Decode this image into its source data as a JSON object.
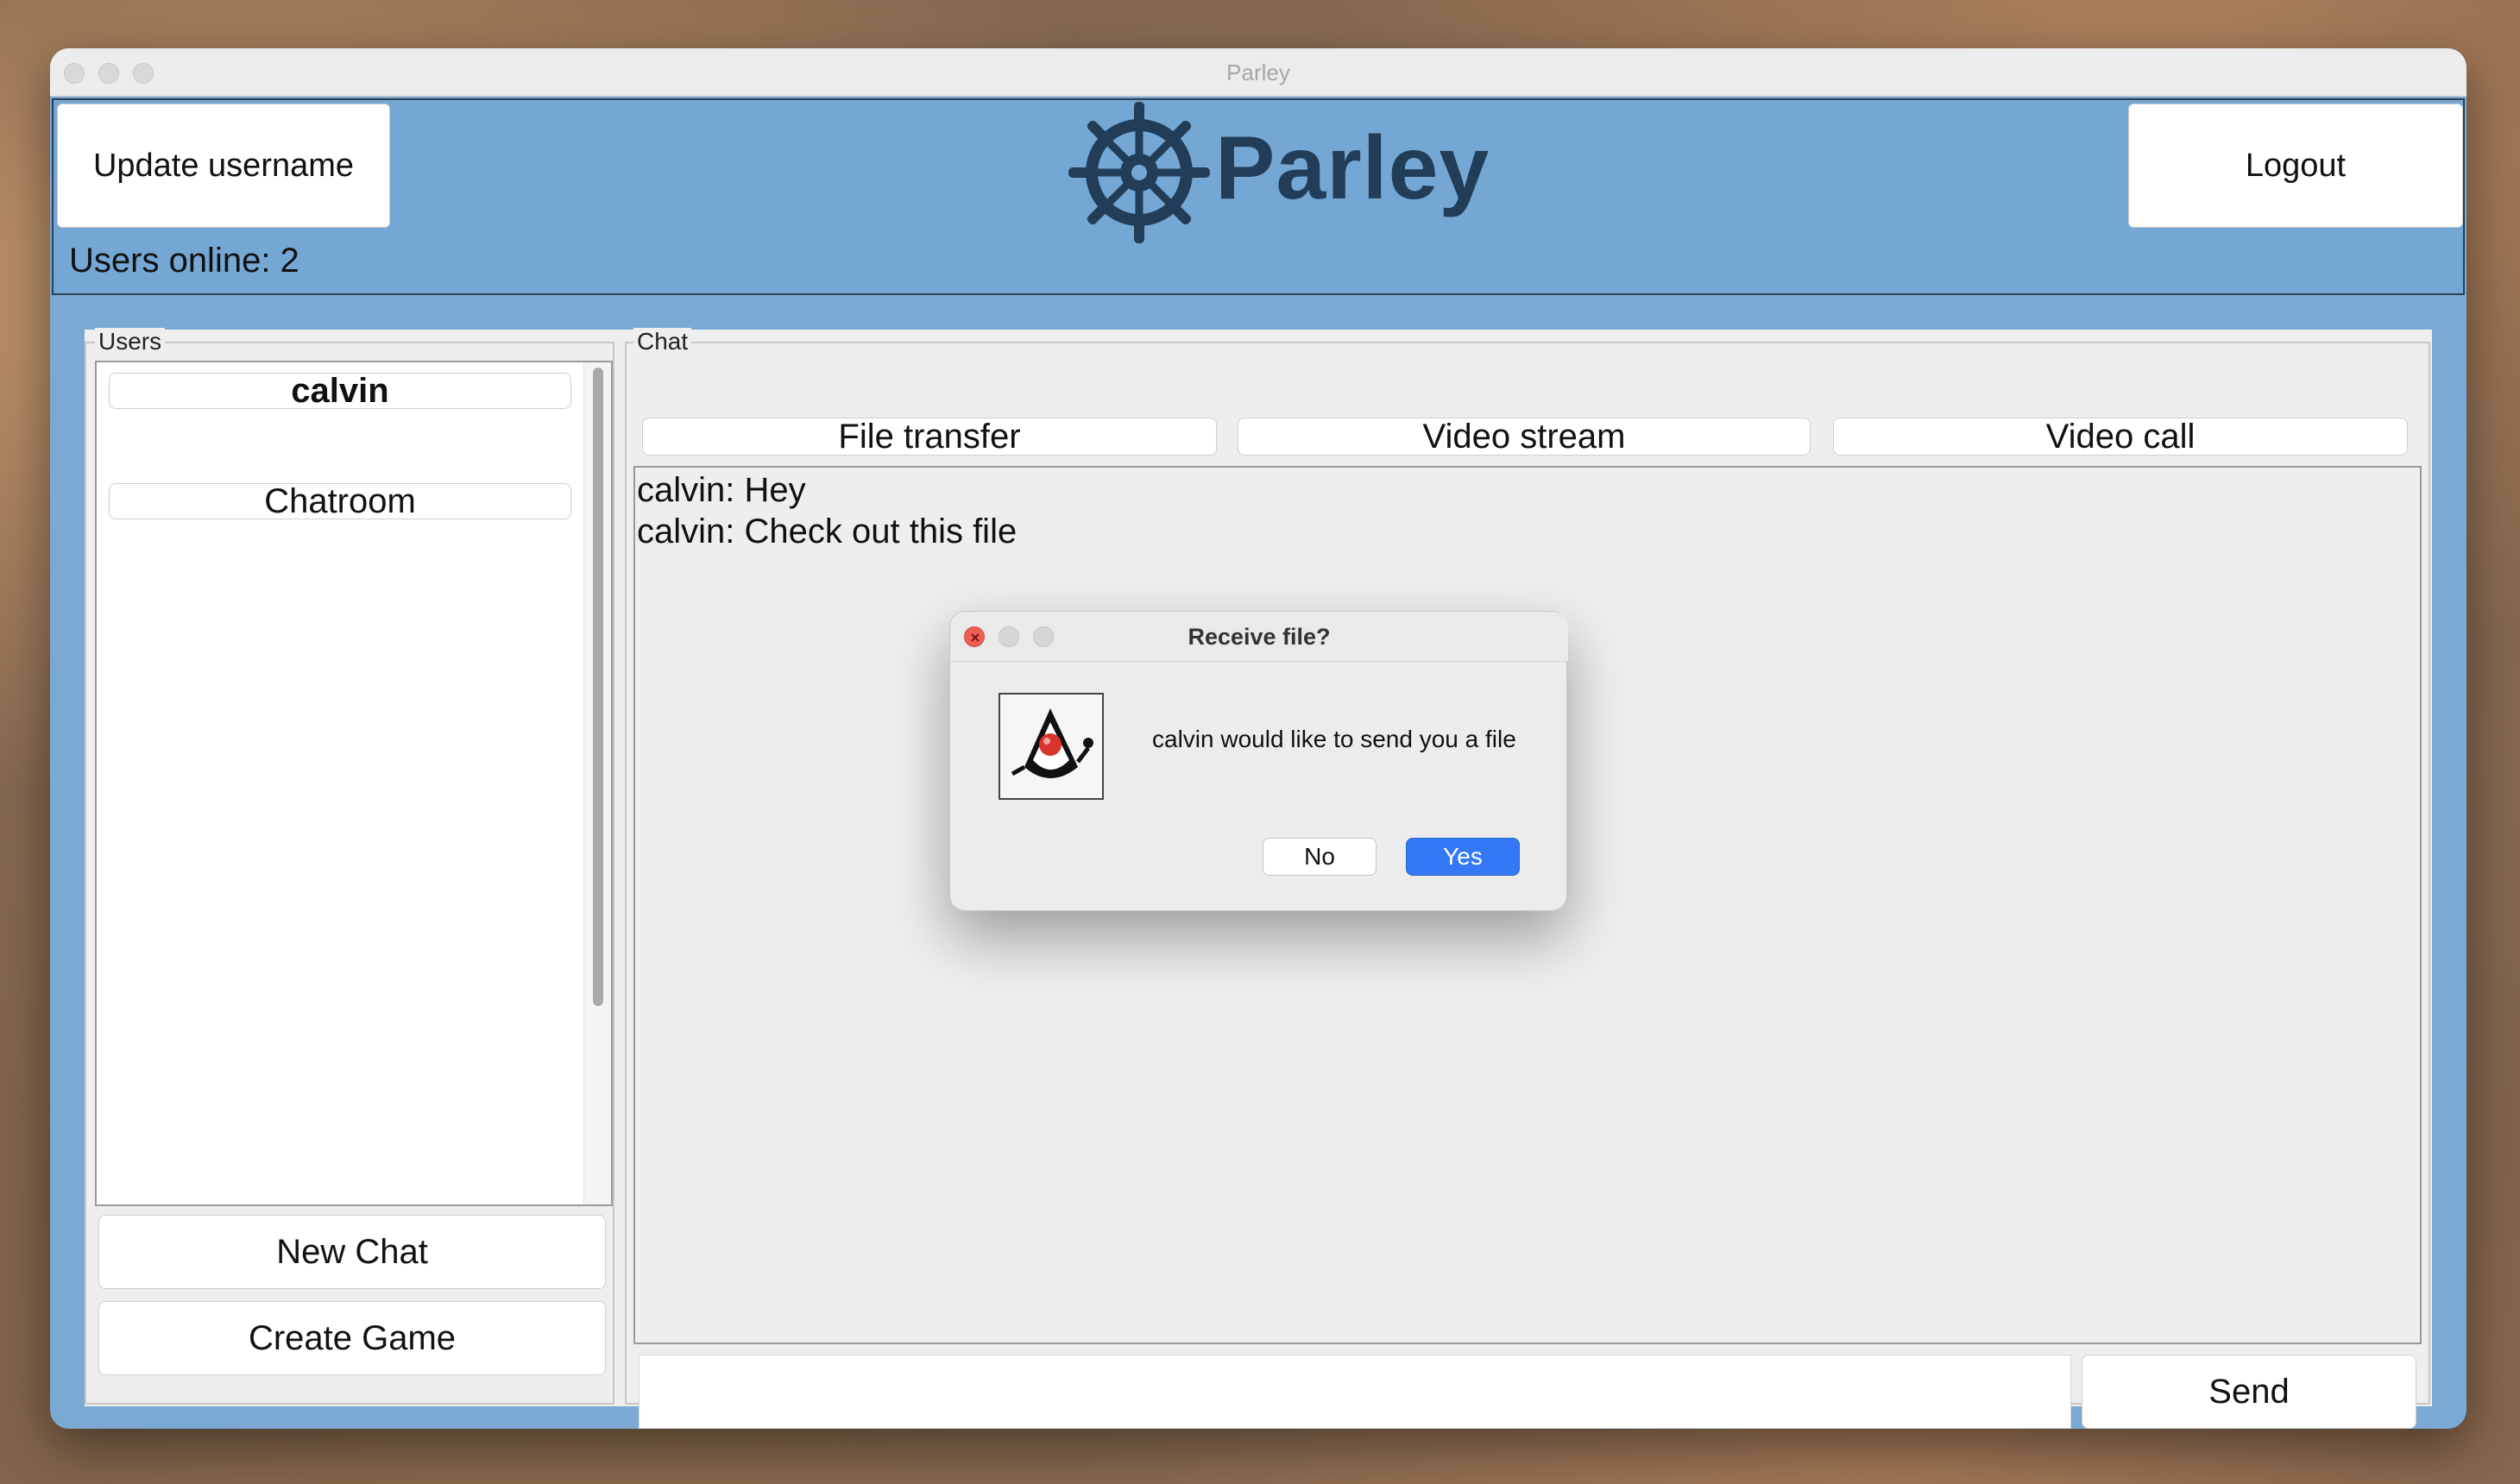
{
  "window": {
    "title": "Parley"
  },
  "header": {
    "update_username": "Update username",
    "logout": "Logout",
    "brand": "Parley",
    "users_online": "Users online: 2"
  },
  "users_panel": {
    "label": "Users",
    "items": [
      {
        "label": "calvin"
      },
      {
        "label": "Chatroom"
      }
    ],
    "new_chat": "New Chat",
    "create_game": "Create Game"
  },
  "chat_panel": {
    "label": "Chat",
    "tabs": [
      "File transfer",
      "Video stream",
      "Video call"
    ],
    "messages": [
      "calvin: Hey",
      "calvin: Check out this file"
    ],
    "input_value": "",
    "send": "Send"
  },
  "dialog": {
    "title": "Receive file?",
    "message": "calvin would like to send you a file",
    "no": "No",
    "yes": "Yes",
    "accent": "#3478f6"
  }
}
